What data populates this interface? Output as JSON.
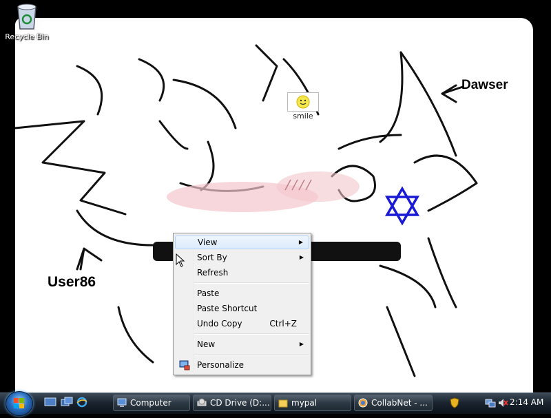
{
  "desktop": {
    "icons": [
      {
        "label": "Recycle Bin",
        "icon": "recycle-bin-icon"
      },
      {
        "label": "smile",
        "icon": "smiley-icon"
      }
    ],
    "annotations": {
      "top_right": "Dawser",
      "bottom_left": "User86"
    }
  },
  "context_menu": {
    "items": [
      {
        "label": "View",
        "submenu": true,
        "highlighted": true
      },
      {
        "label": "Sort By",
        "submenu": true
      },
      {
        "label": "Refresh"
      },
      {
        "label": "Paste"
      },
      {
        "label": "Paste Shortcut"
      },
      {
        "label": "Undo Copy",
        "shortcut": "Ctrl+Z"
      },
      {
        "label": "New",
        "submenu": true
      },
      {
        "label": "Personalize",
        "icon": "personalize-icon"
      }
    ],
    "submenu_glyph": "▶"
  },
  "taskbar": {
    "quick_launch": [
      "show-desktop-icon",
      "switch-windows-icon",
      "internet-explorer-icon"
    ],
    "buttons": [
      {
        "label": "Computer",
        "icon": "computer-icon"
      },
      {
        "label": "CD Drive (D:...",
        "icon": "cd-drive-icon"
      },
      {
        "label": "mypal",
        "icon": "folder-icon"
      },
      {
        "label": "CollabNet - ...",
        "icon": "browser-icon"
      }
    ],
    "tray_icons": [
      "security-shield-icon",
      "network-icon",
      "volume-muted-icon"
    ],
    "clock": "2:14 AM"
  },
  "colors": {
    "taskbar": "#1b2530",
    "menu_bg": "#f0f0f0",
    "star": "#1a1ad6"
  }
}
